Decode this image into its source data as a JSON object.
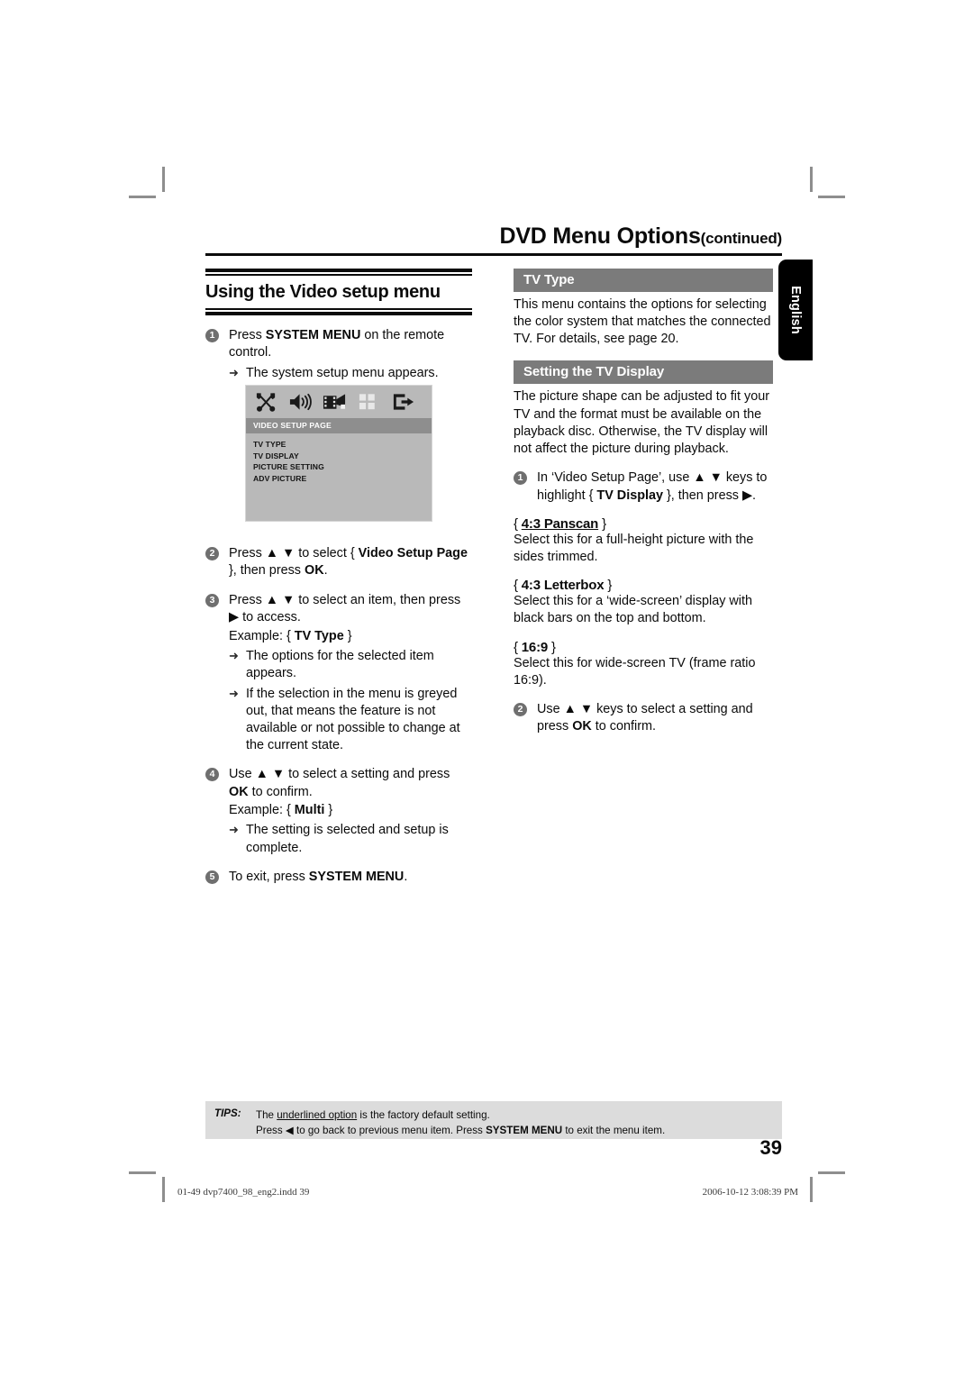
{
  "page": {
    "header_title": "DVD Menu Options",
    "header_continued": "(continued)",
    "side_tab": "English",
    "page_number": "39"
  },
  "left_column": {
    "section_heading": "Using the Video setup menu",
    "steps": [
      {
        "num": "1",
        "text_html": "Press <b>SYSTEM MENU</b> on the remote control.",
        "notes": [
          "The system setup menu appears."
        ]
      },
      {
        "num": "2",
        "text_html": "Press ▲ ▼ to select { <b>Video Setup Page</b> }, then press <b>OK</b>.",
        "notes": []
      },
      {
        "num": "3",
        "text_html": "Press ▲ ▼ to select an item, then press ▶ to access.",
        "example": "Example: { TV Type }",
        "example_bold": "TV Type",
        "notes": [
          "The options for the selected item appears.",
          "If the selection in the menu is greyed out, that means the feature is not available or not possible to change at the current state."
        ]
      },
      {
        "num": "4",
        "text_html": "Use ▲ ▼ to select a setting and press <b>OK</b> to confirm.",
        "example": "Example: { Multi }",
        "example_bold": "Multi",
        "notes": [
          "The setting is selected and setup is complete."
        ]
      },
      {
        "num": "5",
        "text_html": "To exit, press <b>SYSTEM MENU</b>.",
        "notes": []
      }
    ]
  },
  "setup_menu_screenshot": {
    "icons": [
      "tools-icon",
      "speaker-icon",
      "video-film-icon",
      "preferences-grid-icon",
      "exit-arrow-icon"
    ],
    "page_bar": "VIDEO SETUP PAGE",
    "items": [
      "TV TYPE",
      "TV DISPLAY",
      "PICTURE SETTING",
      "ADV PICTURE"
    ]
  },
  "right_column": {
    "tv_type": {
      "heading": "TV Type",
      "body": "This menu contains the options for selecting the color system that matches the connected TV. For details, see page 20."
    },
    "tv_display": {
      "heading": "Setting the TV Display",
      "body": "The picture shape can be adjusted to fit your TV and the format must be available on the playback disc. Otherwise, the TV display will not affect the picture during playback.",
      "step1_html": "In ‘Video Setup Page’, use ▲ ▼ keys to highlight { <b>TV Display</b> }, then press ▶.",
      "step1_num": "1",
      "options": [
        {
          "name": "4:3 Panscan",
          "underlined": true,
          "description": "Select this for a full-height picture with the sides trimmed."
        },
        {
          "name": "4:3 Letterbox",
          "underlined": false,
          "description": "Select this for a ‘wide-screen’ display with black bars on the top and bottom."
        },
        {
          "name": "16:9",
          "underlined": false,
          "description": "Select this for wide-screen TV (frame ratio 16:9)."
        }
      ],
      "step2_num": "2",
      "step2_html": "Use ▲ ▼ keys to select a setting and press <b>OK</b> to confirm."
    }
  },
  "tips": {
    "label": "TIPS:",
    "line1_html": "The <u>underlined option</u> is the factory default setting.",
    "line2_html": "Press ◀ to go back to previous menu item. Press <b>SYSTEM MENU</b> to exit the menu item."
  },
  "print_slug": {
    "left": "01-49 dvp7400_98_eng2.indd   39",
    "right": "2006-10-12   3:08:39 PM"
  },
  "colors": {
    "section_header_gray": "#7b7b7b",
    "menu_bg_gray": "#b9b9b9",
    "menu_bar_gray": "#8e8e8e",
    "tips_gray": "#dcdcdc",
    "bullet_gray": "#6f6f6f"
  }
}
